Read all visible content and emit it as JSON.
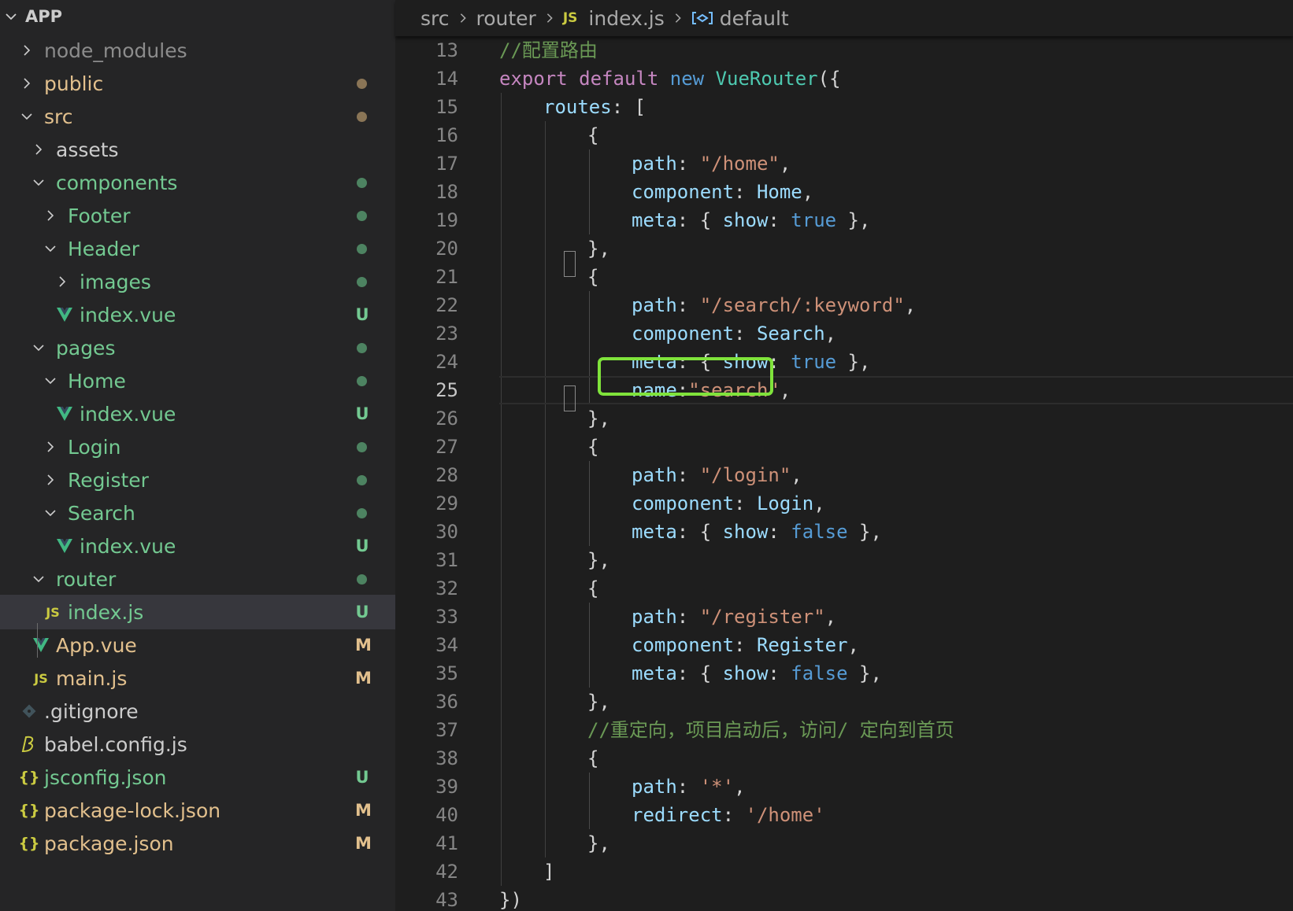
{
  "explorer": {
    "title": "APP",
    "items": [
      {
        "label": "node_modules",
        "type": "folder",
        "expanded": false,
        "depth": 1,
        "color": "#8c8c8c",
        "status": "",
        "status_type": "none"
      },
      {
        "label": "public",
        "type": "folder",
        "expanded": false,
        "depth": 1,
        "color": "#e2c08d",
        "status": "",
        "status_type": "dot",
        "status_color": "#8a7556"
      },
      {
        "label": "src",
        "type": "folder",
        "expanded": true,
        "depth": 1,
        "color": "#e2c08d",
        "status": "",
        "status_type": "dot",
        "status_color": "#8a7556"
      },
      {
        "label": "assets",
        "type": "folder",
        "expanded": false,
        "depth": 2,
        "color": "#cccccc",
        "status": "",
        "status_type": "none"
      },
      {
        "label": "components",
        "type": "folder",
        "expanded": true,
        "depth": 2,
        "color": "#73c991",
        "status": "",
        "status_type": "dot",
        "status_color": "#4d8361"
      },
      {
        "label": "Footer",
        "type": "folder",
        "expanded": false,
        "depth": 3,
        "color": "#73c991",
        "status": "",
        "status_type": "dot",
        "status_color": "#4d8361"
      },
      {
        "label": "Header",
        "type": "folder",
        "expanded": true,
        "depth": 3,
        "color": "#73c991",
        "status": "",
        "status_type": "dot",
        "status_color": "#4d8361"
      },
      {
        "label": "images",
        "type": "folder",
        "expanded": false,
        "depth": 4,
        "color": "#73c991",
        "status": "",
        "status_type": "dot",
        "status_color": "#4d8361"
      },
      {
        "label": "index.vue",
        "type": "vue",
        "depth": 4,
        "color": "#73c991",
        "status": "U",
        "status_type": "letter",
        "status_color": "#73c991"
      },
      {
        "label": "pages",
        "type": "folder",
        "expanded": true,
        "depth": 2,
        "color": "#73c991",
        "status": "",
        "status_type": "dot",
        "status_color": "#4d8361"
      },
      {
        "label": "Home",
        "type": "folder",
        "expanded": true,
        "depth": 3,
        "color": "#73c991",
        "status": "",
        "status_type": "dot",
        "status_color": "#4d8361"
      },
      {
        "label": "index.vue",
        "type": "vue",
        "depth": 4,
        "color": "#73c991",
        "status": "U",
        "status_type": "letter",
        "status_color": "#73c991"
      },
      {
        "label": "Login",
        "type": "folder",
        "expanded": false,
        "depth": 3,
        "color": "#73c991",
        "status": "",
        "status_type": "dot",
        "status_color": "#4d8361"
      },
      {
        "label": "Register",
        "type": "folder",
        "expanded": false,
        "depth": 3,
        "color": "#73c991",
        "status": "",
        "status_type": "dot",
        "status_color": "#4d8361"
      },
      {
        "label": "Search",
        "type": "folder",
        "expanded": true,
        "depth": 3,
        "color": "#73c991",
        "status": "",
        "status_type": "dot",
        "status_color": "#4d8361"
      },
      {
        "label": "index.vue",
        "type": "vue",
        "depth": 4,
        "color": "#73c991",
        "status": "U",
        "status_type": "letter",
        "status_color": "#73c991"
      },
      {
        "label": "router",
        "type": "folder",
        "expanded": true,
        "depth": 2,
        "color": "#73c991",
        "status": "",
        "status_type": "dot",
        "status_color": "#4d8361"
      },
      {
        "label": "index.js",
        "type": "js",
        "depth": 3,
        "color": "#73c991",
        "status": "U",
        "status_type": "letter",
        "status_color": "#73c991",
        "selected": true
      },
      {
        "label": "App.vue",
        "type": "vue",
        "depth": 2,
        "color": "#e2c08d",
        "status": "M",
        "status_type": "letter",
        "status_color": "#e2c08d"
      },
      {
        "label": "main.js",
        "type": "js",
        "depth": 2,
        "color": "#e2c08d",
        "status": "M",
        "status_type": "letter",
        "status_color": "#e2c08d"
      },
      {
        "label": ".gitignore",
        "type": "git",
        "depth": 1,
        "color": "#cccccc",
        "status": "",
        "status_type": "none"
      },
      {
        "label": "babel.config.js",
        "type": "babel",
        "depth": 1,
        "color": "#cccccc",
        "status": "",
        "status_type": "none"
      },
      {
        "label": "jsconfig.json",
        "type": "json",
        "depth": 1,
        "color": "#73c991",
        "status": "U",
        "status_type": "letter",
        "status_color": "#73c991"
      },
      {
        "label": "package-lock.json",
        "type": "json",
        "depth": 1,
        "color": "#e2c08d",
        "status": "M",
        "status_type": "letter",
        "status_color": "#e2c08d"
      },
      {
        "label": "package.json",
        "type": "json",
        "depth": 1,
        "color": "#e2c08d",
        "status": "M",
        "status_type": "letter",
        "status_color": "#e2c08d"
      }
    ]
  },
  "breadcrumb": {
    "parts": [
      "src",
      "router",
      "index.js",
      "default"
    ],
    "file_badge": "JS"
  },
  "editor": {
    "current_line": 25,
    "highlighted_line": 25,
    "lines": [
      {
        "n": 13,
        "indent": 0,
        "tokens": [
          [
            "cmt",
            "//配置路由"
          ]
        ]
      },
      {
        "n": 14,
        "indent": 0,
        "tokens": [
          [
            "kw",
            "export"
          ],
          [
            "pun",
            " "
          ],
          [
            "kw",
            "default"
          ],
          [
            "pun",
            " "
          ],
          [
            "kw2",
            "new"
          ],
          [
            "pun",
            " "
          ],
          [
            "cls",
            "VueRouter"
          ],
          [
            "pun",
            "({"
          ]
        ]
      },
      {
        "n": 15,
        "indent": 1,
        "tokens": [
          [
            "prop",
            "routes"
          ],
          [
            "pun",
            ": ["
          ]
        ]
      },
      {
        "n": 16,
        "indent": 2,
        "tokens": [
          [
            "pun",
            "{"
          ]
        ]
      },
      {
        "n": 17,
        "indent": 3,
        "tokens": [
          [
            "prop",
            "path"
          ],
          [
            "pun",
            ": "
          ],
          [
            "str",
            "\"/home\""
          ],
          [
            "pun",
            ","
          ]
        ]
      },
      {
        "n": 18,
        "indent": 3,
        "tokens": [
          [
            "prop",
            "component"
          ],
          [
            "pun",
            ": "
          ],
          [
            "var",
            "Home"
          ],
          [
            "pun",
            ","
          ]
        ]
      },
      {
        "n": 19,
        "indent": 3,
        "tokens": [
          [
            "prop",
            "meta"
          ],
          [
            "pun",
            ": { "
          ],
          [
            "prop",
            "show"
          ],
          [
            "pun",
            ": "
          ],
          [
            "kw2",
            "true"
          ],
          [
            "pun",
            " },"
          ]
        ]
      },
      {
        "n": 20,
        "indent": 2,
        "tokens": [
          [
            "pun",
            "},"
          ]
        ]
      },
      {
        "n": 21,
        "indent": 2,
        "tokens": [
          [
            "pun",
            "{"
          ]
        ]
      },
      {
        "n": 22,
        "indent": 3,
        "tokens": [
          [
            "prop",
            "path"
          ],
          [
            "pun",
            ": "
          ],
          [
            "str",
            "\"/search/:keyword\""
          ],
          [
            "pun",
            ","
          ]
        ]
      },
      {
        "n": 23,
        "indent": 3,
        "tokens": [
          [
            "prop",
            "component"
          ],
          [
            "pun",
            ": "
          ],
          [
            "var",
            "Search"
          ],
          [
            "pun",
            ","
          ]
        ]
      },
      {
        "n": 24,
        "indent": 3,
        "tokens": [
          [
            "prop",
            "meta"
          ],
          [
            "pun",
            ": { "
          ],
          [
            "prop",
            "show"
          ],
          [
            "pun",
            ": "
          ],
          [
            "kw2",
            "true"
          ],
          [
            "pun",
            " },"
          ]
        ]
      },
      {
        "n": 25,
        "indent": 3,
        "tokens": [
          [
            "prop",
            "name"
          ],
          [
            "pun",
            ":"
          ],
          [
            "str",
            "\"search\""
          ],
          [
            "pun",
            ","
          ]
        ]
      },
      {
        "n": 26,
        "indent": 2,
        "tokens": [
          [
            "pun",
            "},"
          ]
        ]
      },
      {
        "n": 27,
        "indent": 2,
        "tokens": [
          [
            "pun",
            "{"
          ]
        ]
      },
      {
        "n": 28,
        "indent": 3,
        "tokens": [
          [
            "prop",
            "path"
          ],
          [
            "pun",
            ": "
          ],
          [
            "str",
            "\"/login\""
          ],
          [
            "pun",
            ","
          ]
        ]
      },
      {
        "n": 29,
        "indent": 3,
        "tokens": [
          [
            "prop",
            "component"
          ],
          [
            "pun",
            ": "
          ],
          [
            "var",
            "Login"
          ],
          [
            "pun",
            ","
          ]
        ]
      },
      {
        "n": 30,
        "indent": 3,
        "tokens": [
          [
            "prop",
            "meta"
          ],
          [
            "pun",
            ": { "
          ],
          [
            "prop",
            "show"
          ],
          [
            "pun",
            ": "
          ],
          [
            "kw2",
            "false"
          ],
          [
            "pun",
            " },"
          ]
        ]
      },
      {
        "n": 31,
        "indent": 2,
        "tokens": [
          [
            "pun",
            "},"
          ]
        ]
      },
      {
        "n": 32,
        "indent": 2,
        "tokens": [
          [
            "pun",
            "{"
          ]
        ]
      },
      {
        "n": 33,
        "indent": 3,
        "tokens": [
          [
            "prop",
            "path"
          ],
          [
            "pun",
            ": "
          ],
          [
            "str",
            "\"/register\""
          ],
          [
            "pun",
            ","
          ]
        ]
      },
      {
        "n": 34,
        "indent": 3,
        "tokens": [
          [
            "prop",
            "component"
          ],
          [
            "pun",
            ": "
          ],
          [
            "var",
            "Register"
          ],
          [
            "pun",
            ","
          ]
        ]
      },
      {
        "n": 35,
        "indent": 3,
        "tokens": [
          [
            "prop",
            "meta"
          ],
          [
            "pun",
            ": { "
          ],
          [
            "prop",
            "show"
          ],
          [
            "pun",
            ": "
          ],
          [
            "kw2",
            "false"
          ],
          [
            "pun",
            " },"
          ]
        ]
      },
      {
        "n": 36,
        "indent": 2,
        "tokens": [
          [
            "pun",
            "},"
          ]
        ]
      },
      {
        "n": 37,
        "indent": 2,
        "tokens": [
          [
            "cmt",
            "//重定向，项目启动后，访问/ 定向到首页"
          ]
        ]
      },
      {
        "n": 38,
        "indent": 2,
        "tokens": [
          [
            "pun",
            "{"
          ]
        ]
      },
      {
        "n": 39,
        "indent": 3,
        "tokens": [
          [
            "prop",
            "path"
          ],
          [
            "pun",
            ": "
          ],
          [
            "str",
            "'*'"
          ],
          [
            "pun",
            ","
          ]
        ]
      },
      {
        "n": 40,
        "indent": 3,
        "tokens": [
          [
            "prop",
            "redirect"
          ],
          [
            "pun",
            ": "
          ],
          [
            "str",
            "'/home'"
          ]
        ]
      },
      {
        "n": 41,
        "indent": 2,
        "tokens": [
          [
            "pun",
            "},"
          ]
        ]
      },
      {
        "n": 42,
        "indent": 1,
        "tokens": [
          [
            "pun",
            "]"
          ]
        ]
      },
      {
        "n": 43,
        "indent": 0,
        "tokens": [
          [
            "pun",
            "})"
          ]
        ]
      }
    ]
  }
}
